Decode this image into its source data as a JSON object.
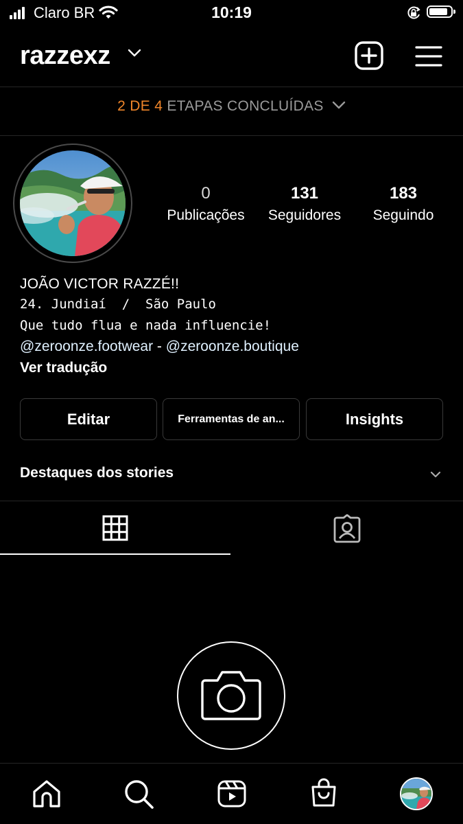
{
  "status_bar": {
    "carrier": "Claro BR",
    "time": "10:19"
  },
  "header": {
    "username": "razzexz",
    "icons": [
      "chevron-down-icon",
      "new-post-icon",
      "menu-icon"
    ]
  },
  "steps": {
    "progress": "2 DE 4",
    "label": "ETAPAS CONCLUÍDAS",
    "accent_color": "#f0862a"
  },
  "stats": [
    {
      "value": "0",
      "label": "Publicações"
    },
    {
      "value": "131",
      "label": "Seguidores"
    },
    {
      "value": "183",
      "label": "Seguindo"
    }
  ],
  "bio": {
    "name": "JOÃO VICTOR RAZZÉ!!",
    "line1": "24. Jundiaí  /  São Paulo",
    "line2": "Que tudo flua e nada influencie!",
    "link1": "@zeroonze.footwear",
    "separator": " - ",
    "link2": "@zeroonze.boutique",
    "translate": "Ver tradução",
    "link_color": "#e0f1ff"
  },
  "buttons": {
    "edit": "Editar",
    "tools": "Ferramentas de an...",
    "insights": "Insights"
  },
  "highlights": {
    "label": "Destaques dos stories"
  },
  "tabs": [
    "grid-icon",
    "tagged-icon"
  ],
  "bottom_nav": [
    "home-icon",
    "search-icon",
    "reels-icon",
    "shop-icon",
    "profile-avatar"
  ]
}
